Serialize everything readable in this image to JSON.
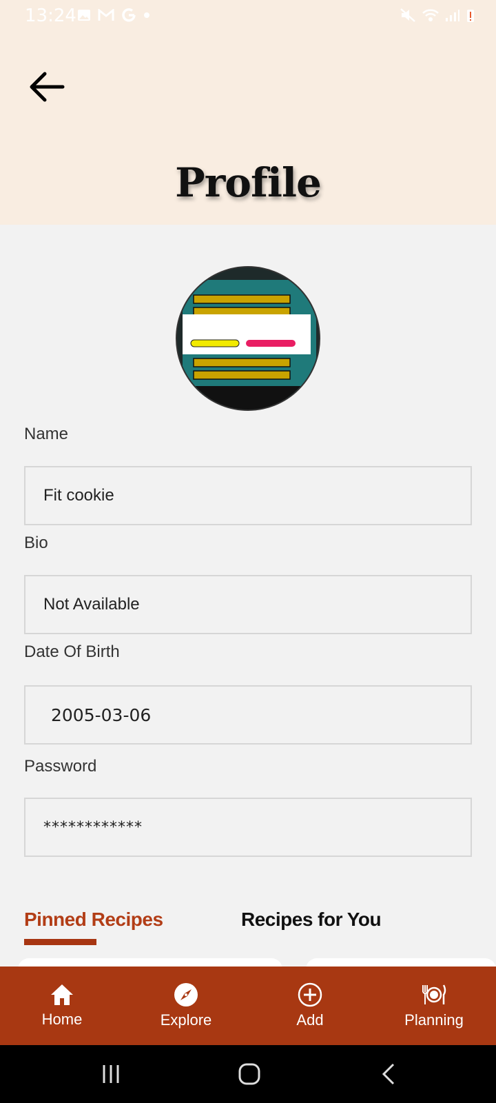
{
  "status_bar": {
    "time": "13:24",
    "notification_icons": [
      "image-icon",
      "gmail-icon",
      "google-icon",
      "dot-icon"
    ],
    "system_icons": [
      "mute-icon",
      "wifi-icon",
      "signal-icon",
      "battery-alert-icon"
    ]
  },
  "header": {
    "title": "Profile",
    "back_icon": "arrow-left-icon"
  },
  "form": {
    "name_label": "Name",
    "name_value": "Fit cookie",
    "bio_label": "Bio",
    "bio_value": "Not Available",
    "dob_label": "Date Of Birth",
    "dob_value": "2005-03-06",
    "password_label": "Password",
    "password_value": "************"
  },
  "tabs": [
    {
      "label": "Pinned Recipes",
      "active": true
    },
    {
      "label": "Recipes for You",
      "active": false
    }
  ],
  "bottom_nav": [
    {
      "label": "Home",
      "icon": "home-icon"
    },
    {
      "label": "Explore",
      "icon": "compass-icon"
    },
    {
      "label": "Add",
      "icon": "add-circle-icon"
    },
    {
      "label": "Planning",
      "icon": "plate-cutlery-icon"
    }
  ],
  "colors": {
    "header_bg": "#f9ede1",
    "accent": "#a83812",
    "page_bg": "#f2f2f2"
  }
}
